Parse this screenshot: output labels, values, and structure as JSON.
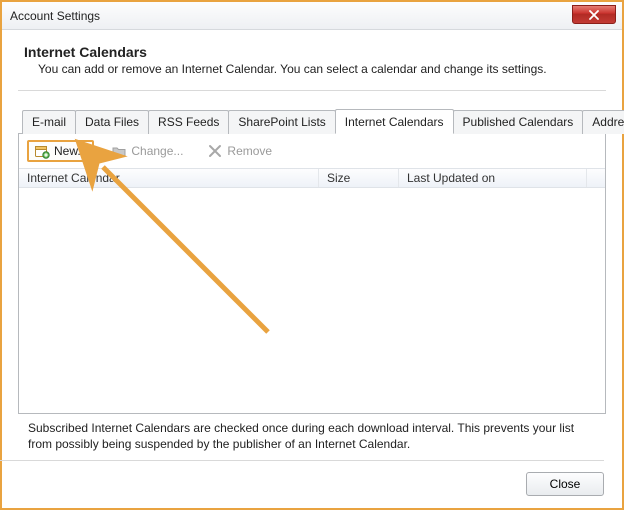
{
  "titlebar": {
    "title": "Account Settings"
  },
  "header": {
    "heading": "Internet Calendars",
    "sub": "You can add or remove an Internet Calendar. You can select a calendar and change its settings."
  },
  "tabs": {
    "email": "E-mail",
    "datafiles": "Data Files",
    "rss": "RSS Feeds",
    "sharepoint": "SharePoint Lists",
    "internet": "Internet Calendars",
    "published": "Published Calendars",
    "address": "Address Books"
  },
  "toolbar": {
    "new": "New...",
    "change": "Change...",
    "remove": "Remove"
  },
  "columns": {
    "name": "Internet Calendar",
    "size": "Size",
    "updated": "Last Updated on"
  },
  "footnote": "Subscribed Internet Calendars are checked once during each download interval. This prevents your list from possibly being suspended by the publisher of an Internet Calendar.",
  "footer": {
    "close": "Close"
  }
}
